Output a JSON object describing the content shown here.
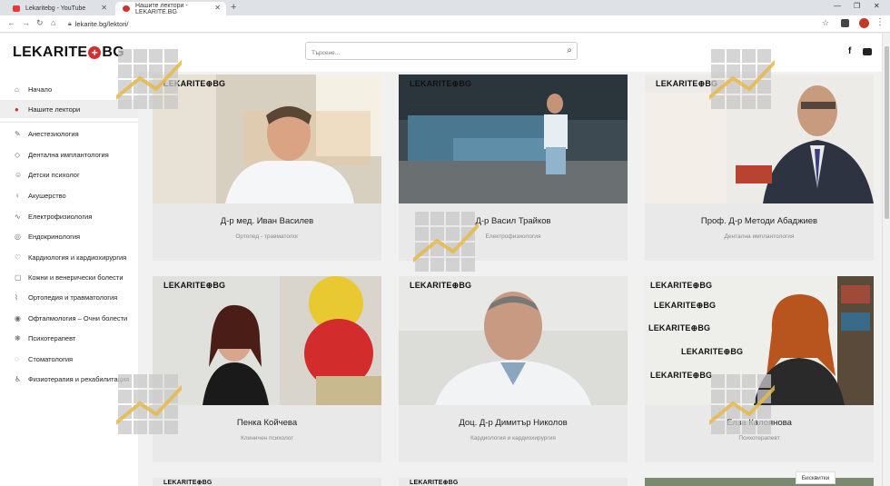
{
  "browser": {
    "tabs": [
      {
        "title": "Lekaritebg - YouTube"
      },
      {
        "title": "Нашите лектори - LEKARITE.BG"
      }
    ],
    "url": "lekarite.bg/lektori/"
  },
  "header": {
    "logo_left": "LEKARITE",
    "logo_right": "BG",
    "search_placeholder": "Търсене..."
  },
  "sidebar": {
    "main": [
      {
        "label": "Начало",
        "icon": "home-icon"
      },
      {
        "label": "Нашите лектори",
        "icon": "users-icon"
      }
    ],
    "categories": [
      {
        "label": "Анестезиология",
        "icon": "syringe-icon"
      },
      {
        "label": "Дентална имплантология",
        "icon": "tooth-icon"
      },
      {
        "label": "Детски психолог",
        "icon": "child-icon"
      },
      {
        "label": "Акушерство",
        "icon": "pregnancy-icon"
      },
      {
        "label": "Електрофизиология",
        "icon": "pulse-icon"
      },
      {
        "label": "Ендокринология",
        "icon": "gland-icon"
      },
      {
        "label": "Кардиология и кардиохирургия",
        "icon": "heart-icon"
      },
      {
        "label": "Кожни и венерически болести",
        "icon": "skin-icon"
      },
      {
        "label": "Ортопедия и травматология",
        "icon": "bone-icon"
      },
      {
        "label": "Офталмология – Очни болести",
        "icon": "eye-icon"
      },
      {
        "label": "Психотерапевт",
        "icon": "brain-icon"
      },
      {
        "label": "Стоматология",
        "icon": "dental-icon"
      },
      {
        "label": "Физиотерапия и рехабилитация",
        "icon": "rehab-icon"
      }
    ]
  },
  "lecturers": [
    {
      "name": "Д-р мед. Иван Василев",
      "specialty": "Ортопед - травматолог"
    },
    {
      "name": "Д-р Васил Трайков",
      "specialty": "Електрофизиология"
    },
    {
      "name": "Проф. Д-р Методи Абаджиев",
      "specialty": "Дентална имплантология"
    },
    {
      "name": "Пенка Койчева",
      "specialty": "Клиничен психолог"
    },
    {
      "name": "Доц. Д-р Димитър Николов",
      "specialty": "Кардиология и кардиохирургия"
    },
    {
      "name": "Елза Калоянова",
      "specialty": "Психотерапевт"
    }
  ],
  "cookie_label": "Бисквитки",
  "colors": {
    "brand_red": "#d32f2f",
    "accent_gold": "#e6b84a"
  }
}
